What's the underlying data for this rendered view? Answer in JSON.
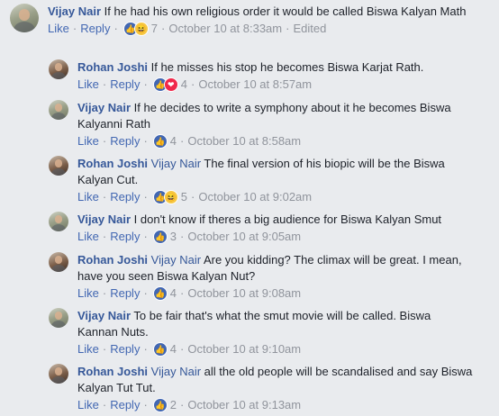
{
  "comments": [
    {
      "author": "Vijay Nair",
      "mention": "",
      "text": "If he had his own religious order it would be called Biswa Kalyan Math",
      "like": "Like",
      "reply": "Reply",
      "count": "7",
      "time": "October 10 at 8:33am",
      "edited": "Edited",
      "reactions": [
        "like",
        "haha"
      ]
    },
    {
      "author": "Rohan Joshi",
      "mention": "",
      "text": "If he misses his stop he becomes Biswa Karjat Rath.",
      "like": "Like",
      "reply": "Reply",
      "count": "4",
      "time": "October 10 at 8:57am",
      "reactions": [
        "like",
        "love"
      ]
    },
    {
      "author": "Vijay Nair",
      "mention": "",
      "text": "If he decides to write a symphony about it he becomes Biswa Kalyanni Rath",
      "like": "Like",
      "reply": "Reply",
      "count": "4",
      "time": "October 10 at 8:58am",
      "reactions": [
        "like"
      ]
    },
    {
      "author": "Rohan Joshi",
      "mention": "Vijay Nair",
      "text": "The final version of his biopic will be the Biswa Kalyan Cut.",
      "like": "Like",
      "reply": "Reply",
      "count": "5",
      "time": "October 10 at 9:02am",
      "reactions": [
        "like",
        "haha"
      ]
    },
    {
      "author": "Vijay Nair",
      "mention": "",
      "text": "I don't know if theres a big audience for Biswa Kalyan Smut",
      "like": "Like",
      "reply": "Reply",
      "count": "3",
      "time": "October 10 at 9:05am",
      "reactions": [
        "like"
      ]
    },
    {
      "author": "Rohan Joshi",
      "mention": "Vijay Nair",
      "text": "Are you kidding? The climax will be great. I mean, have you seen Biswa Kalyan Nut?",
      "like": "Like",
      "reply": "Reply",
      "count": "4",
      "time": "October 10 at 9:08am",
      "reactions": [
        "like"
      ]
    },
    {
      "author": "Vijay Nair",
      "mention": "",
      "text": "To be fair that's what the smut movie will be called. Biswa Kannan Nuts.",
      "like": "Like",
      "reply": "Reply",
      "count": "4",
      "time": "October 10 at 9:10am",
      "reactions": [
        "like"
      ]
    },
    {
      "author": "Rohan Joshi",
      "mention": "Vijay Nair",
      "text": "all the old people will be scandalised and say Biswa Kalyan Tut Tut.",
      "like": "Like",
      "reply": "Reply",
      "count": "2",
      "time": "October 10 at 9:13am",
      "reactions": [
        "like"
      ]
    }
  ],
  "colors": {
    "link": "#4267b2",
    "name": "#365899",
    "meta": "#90949c",
    "background": "#e9ebee",
    "like_reaction": "#4267b2",
    "haha_reaction": "#f7c844",
    "love_reaction": "#f0284a"
  }
}
